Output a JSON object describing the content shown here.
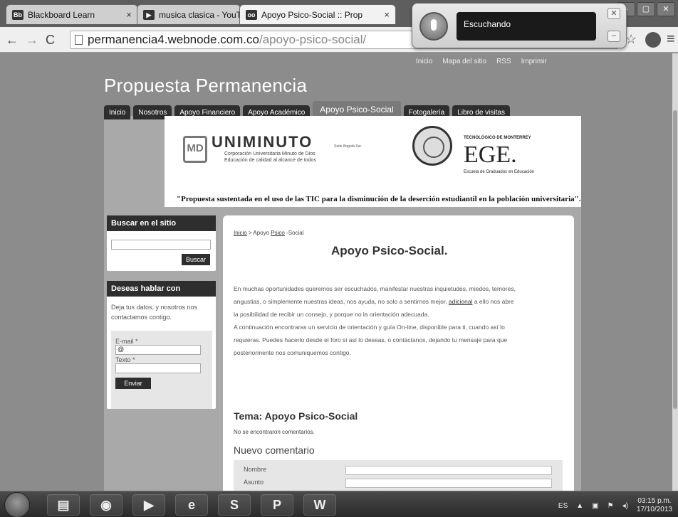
{
  "browser": {
    "tabs": [
      {
        "label": "Blackboard Learn",
        "favicon": "Bb"
      },
      {
        "label": "musica clasica - YouTube",
        "favicon": "▶"
      },
      {
        "label": "Apoyo Psico-Social :: Prop",
        "favicon": "oo"
      }
    ],
    "url_domain": "permanencia4.webnode.com.co",
    "url_path": "/apoyo-psico-social/",
    "voice_status": "Escuchando"
  },
  "page": {
    "top_links": [
      "Inicio",
      "Mapa del sitio",
      "RSS",
      "Imprimir"
    ],
    "site_title": "Propuesta Permanencia",
    "nav": [
      "Inicio",
      "Nosotros",
      "Apoyo Financiero",
      "Apoyo Académico",
      "Apoyo Psico-Social",
      "Fotogalería",
      "Libro de visitas"
    ],
    "banner": {
      "unim_mark": "MD",
      "unim_name": "UNIMINUTO",
      "unim_sub1": "Corporación Universitaria Minuto de Dios",
      "unim_sub2": "Educación de calidad al alcance de todos",
      "sede": "Sede Bogotá Sur",
      "tec_text": "TECNOLÓGICO DE MONTERREY",
      "ege": "EGE.",
      "ege_sub": "Escuela de Graduados en Educación"
    },
    "tagline": "\"Propuesta sustentada en el uso de las TIC para la disminución de la deserción estudiantil en la población universitaria\".",
    "search": {
      "title": "Buscar en el sitio",
      "button": "Buscar"
    },
    "contact": {
      "title": "Deseas hablar con",
      "desc": "Deja tus datos, y nosotros nos contactamos contigo.",
      "email_label": "E-mail *",
      "email_value": "@",
      "text_label": "Texto *",
      "send": "Enviar"
    },
    "breadcrumb": {
      "home": "Inicio",
      "sep": " > Apoyo ",
      "psico": "Psico",
      "rest": " -Social"
    },
    "content_title": "Apoyo Psico-Social.",
    "para1_a": "En muchas oportunidades queremos ser escuchados, manifestar nuestras inquietudes, miedos, temores,",
    "para1_b": "angustias, o simplemente nuestras  ideas, nos ayuda, no solo a sentirnos mejor, ",
    "para1_link": "adicional",
    "para1_c": " a ello nos abre",
    "para1_d": "la posibilidad de recibir un consejo, y porque no la orientación adecuada.",
    "para2_a": "A continuación encontraras un servicio de orientación y guía On-line, disponible para ti, cuando así lo",
    "para2_b": "requieras. Puedes hacerlo desde el foro si así lo deseas, o contáctanos, dejando tu mensaje para que",
    "para2_c": "posteriormente nos comuniquemos contigo.",
    "tema": "Tema: Apoyo Psico-Social",
    "no_comments": "No se encontraron comentarios.",
    "nuevo": "Nuevo comentario",
    "form_labels": [
      "Nombre",
      "Asunto"
    ]
  },
  "taskbar": {
    "lang": "ES",
    "time": "03:15 p.m.",
    "date": "17/10/2013"
  }
}
